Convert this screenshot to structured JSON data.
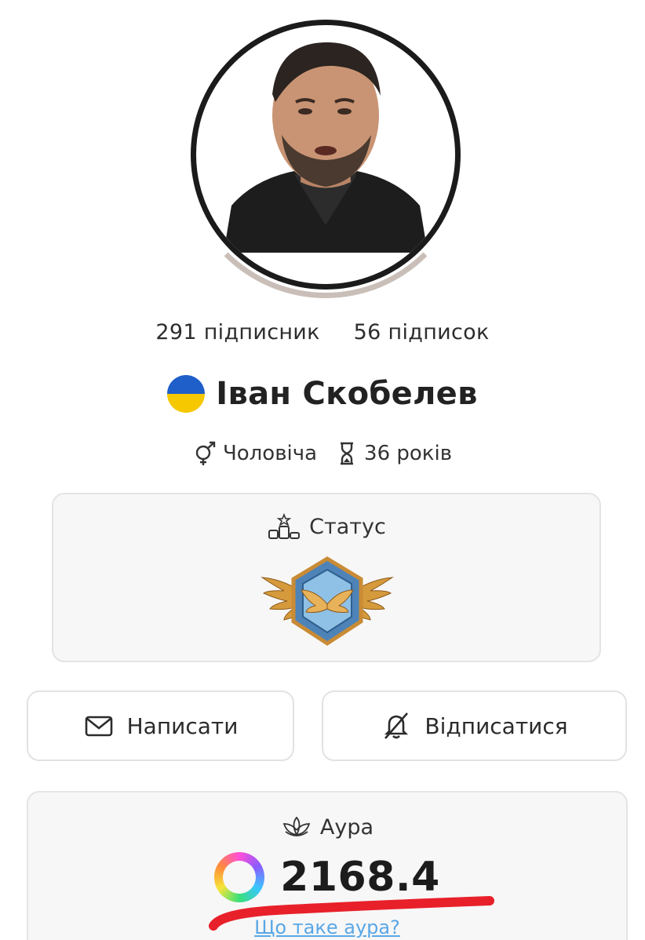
{
  "profile": {
    "followers": "291 підписник",
    "following": "56 підписок",
    "name": "Іван Скобелев",
    "gender": "Чоловіча",
    "age": "36 років"
  },
  "status": {
    "title": "Статус",
    "badge_icon": "winged-shield-badge"
  },
  "actions": {
    "write_label": "Написати",
    "unsubscribe_label": "Відписатися"
  },
  "aura": {
    "title": "Аура",
    "value": "2168.4",
    "link": "Що таке аура?"
  },
  "colors": {
    "flag_blue": "#1f5fc9",
    "flag_yellow": "#f5c800",
    "link": "#5aa7e6",
    "annotation_red": "#e8202a"
  }
}
